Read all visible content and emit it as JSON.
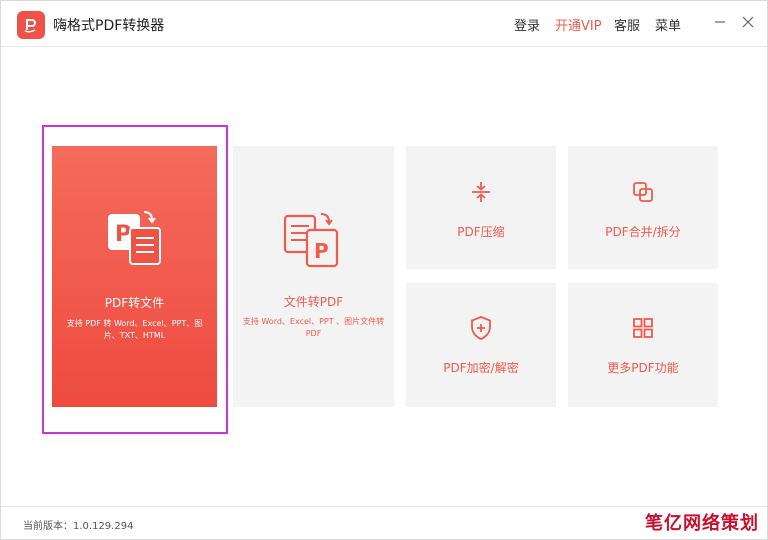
{
  "app": {
    "title": "嗨格式PDF转换器",
    "accent_color": "#ef5b4c"
  },
  "header": {
    "menu": {
      "login": "登录",
      "vip": "开通VIP",
      "service": "客服",
      "menu": "菜单"
    },
    "window_controls": {
      "minimize_icon": "minus",
      "close_icon": "x"
    }
  },
  "cards": {
    "pdf_to_file": {
      "label": "PDF转文件",
      "desc": "支持 PDF 转 Word、Excel、PPT、图片、TXT、HTML"
    },
    "file_to_pdf": {
      "label": "文件转PDF",
      "desc": "支持 Word、Excel、PPT 、图片文件转 PDF"
    },
    "compress": {
      "label": "PDF压缩"
    },
    "merge_split": {
      "label": "PDF合并/拆分"
    },
    "encrypt": {
      "label": "PDF加密/解密"
    },
    "more": {
      "label": "更多PDF功能"
    }
  },
  "status": {
    "version": "当前版本：1.0.129.294"
  },
  "watermark": "笔亿网络策划"
}
